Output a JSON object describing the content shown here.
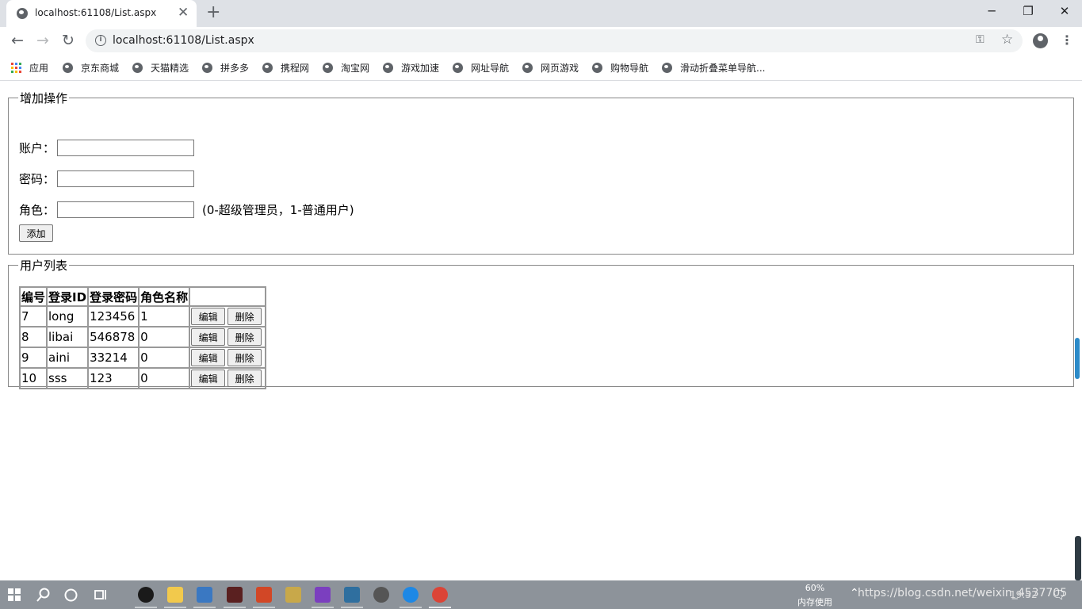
{
  "browser": {
    "tab_title": "localhost:61108/List.aspx",
    "tab_close": "✕",
    "new_tab": "+",
    "url": "localhost:61108/List.aspx",
    "window_controls": {
      "minimize": "─",
      "restore": "❐",
      "close": "✕"
    },
    "nav": {
      "back": "←",
      "forward": "→",
      "reload": "↻"
    }
  },
  "bookmarks": {
    "apps_label": "应用",
    "items": [
      "京东商城",
      "天猫精选",
      "拼多多",
      "携程网",
      "淘宝网",
      "游戏加速",
      "网址导航",
      "网页游戏",
      "购物导航",
      "滑动折叠菜单导航..."
    ]
  },
  "add_section": {
    "legend": "增加操作",
    "account_label": "账户：",
    "password_label": "密码：",
    "role_label": "角色：",
    "account_value": "",
    "password_value": "",
    "role_value": "",
    "role_hint": "(0-超级管理员，1-普通用户)",
    "add_button": "添加"
  },
  "user_list": {
    "legend": "用户列表",
    "headers": [
      "编号",
      "登录ID",
      "登录密码",
      "角色名称",
      ""
    ],
    "rows": [
      {
        "id": "7",
        "login": "long",
        "password": "123456",
        "role": "1"
      },
      {
        "id": "8",
        "login": "libai",
        "password": "546878",
        "role": "0"
      },
      {
        "id": "9",
        "login": "aini",
        "password": "33214",
        "role": "0"
      },
      {
        "id": "10",
        "login": "sss",
        "password": "123",
        "role": "0"
      }
    ],
    "edit_label": "编辑",
    "delete_label": "删除"
  },
  "taskbar": {
    "memory_percent": "60%",
    "memory_label": "内存使用",
    "clock": "19:52",
    "watermark": "https://blog.csdn.net/weixin_4537705"
  },
  "icons": {
    "apps_colors": [
      "#ea4335",
      "#4285f4",
      "#34a853",
      "#fbbc05",
      "#ea4335",
      "#4285f4",
      "#34a853",
      "#fbbc05",
      "#ea4335"
    ]
  }
}
